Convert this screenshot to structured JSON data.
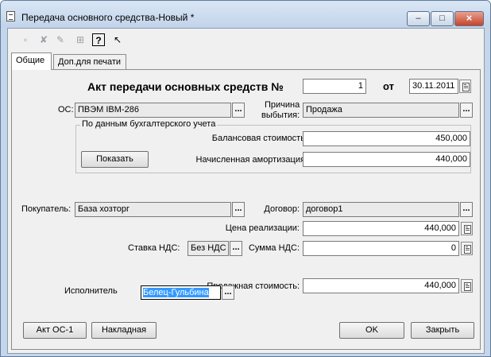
{
  "window": {
    "title": "Передача основного средства-Новый *"
  },
  "tabs": [
    {
      "label": "Общие"
    },
    {
      "label": "Доп.для печати"
    }
  ],
  "form": {
    "heading": "Акт передачи основных средств №",
    "doc_number": "1",
    "from_label": "от",
    "doc_date": "30.11.2011",
    "os_label": "ОС:",
    "os_value": "ПВЭМ IBM-286",
    "reason_label_1": "Причина",
    "reason_label_2": "выбытия:",
    "reason_value": "Продажа",
    "accounting_group_label": "По данным бухгалтерского учета",
    "balance_label": "Балансовая стоимость:",
    "balance_value": "450,000",
    "show_button": "Показать",
    "amortization_label": "Начисленная амортизация:",
    "amortization_value": "440,000",
    "buyer_label": "Покупатель:",
    "buyer_value": "База хозторг",
    "contract_label": "Договор:",
    "contract_value": "договор1",
    "sale_price_label": "Цена реализации:",
    "sale_price_value": "440,000",
    "vat_rate_label": "Ставка НДС:",
    "vat_rate_value": "Без НДС",
    "vat_sum_label": "Сумма НДС:",
    "vat_sum_value": "0",
    "executor_label": "Исполнитель",
    "executor_value": "Белец-Гульбина",
    "sale_cost_label": "Продажная стоимость:",
    "sale_cost_value": "440,000"
  },
  "footer": {
    "act_button": "Акт ОС-1",
    "invoice_button": "Накладная",
    "ok_button": "OK",
    "close_button": "Закрыть"
  }
}
